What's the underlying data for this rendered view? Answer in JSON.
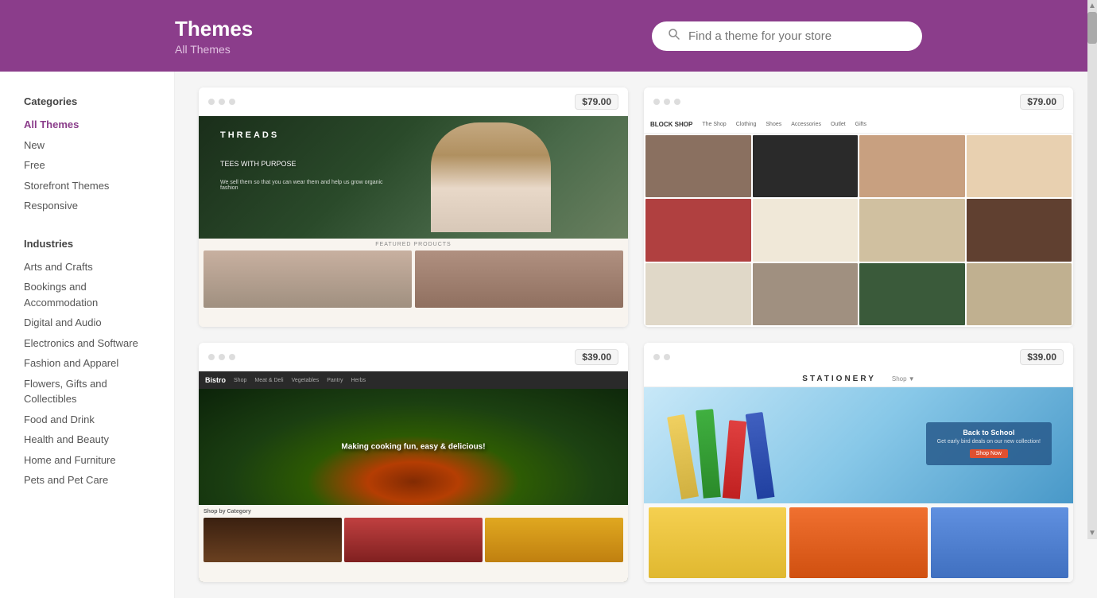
{
  "header": {
    "title": "Themes",
    "subtitle": "All Themes",
    "search_placeholder": "Find a theme for your store"
  },
  "sidebar": {
    "categories_title": "Categories",
    "categories": [
      {
        "label": "All Themes",
        "active": true
      },
      {
        "label": "New"
      },
      {
        "label": "Free"
      },
      {
        "label": "Storefront Themes"
      },
      {
        "label": "Responsive"
      }
    ],
    "industries_title": "Industries",
    "industries": [
      {
        "label": "Arts and Crafts"
      },
      {
        "label": "Bookings and Accommodation"
      },
      {
        "label": "Digital and Audio"
      },
      {
        "label": "Electronics and Software"
      },
      {
        "label": "Fashion and Apparel"
      },
      {
        "label": "Flowers, Gifts and Collectibles"
      },
      {
        "label": "Food and Drink"
      },
      {
        "label": "Health and Beauty"
      },
      {
        "label": "Home and Furniture"
      },
      {
        "label": "Pets and Pet Care"
      }
    ]
  },
  "themes": [
    {
      "name": "Threads",
      "price": "$79.00",
      "type": "fashion"
    },
    {
      "name": "Block Shop",
      "price": "$79.00",
      "type": "blockshop"
    },
    {
      "name": "Bistro",
      "price": "$39.00",
      "type": "bistro"
    },
    {
      "name": "Stationery",
      "price": "$39.00",
      "type": "stationery"
    }
  ],
  "dots": [
    "dot1",
    "dot2",
    "dot3"
  ]
}
